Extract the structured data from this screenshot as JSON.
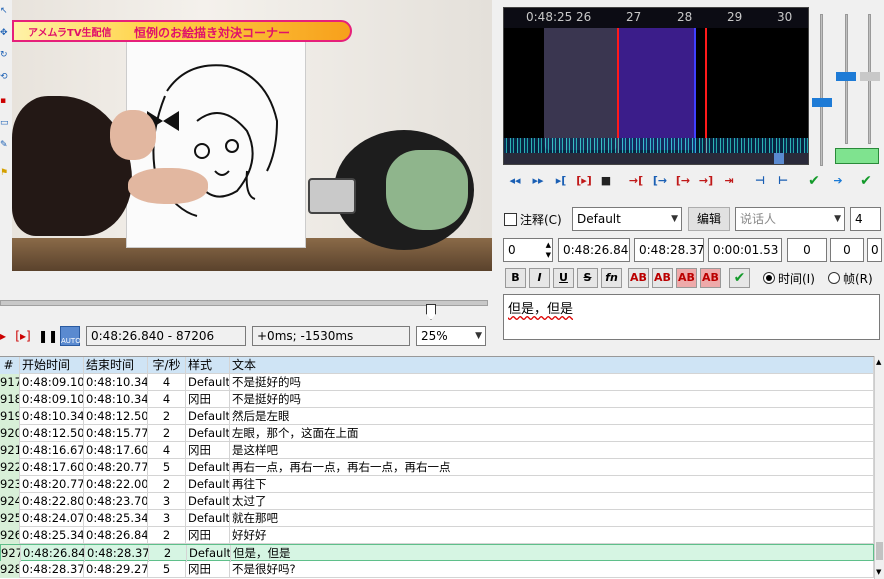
{
  "video": {
    "banner_left": "アメムラTV生配信",
    "banner_title": "恒例のお絵描き対決コーナー"
  },
  "video_controls": {
    "position_text": "0:48:26.840 - 87206",
    "offset_text": "+0ms; -1530ms",
    "zoom_value": "25%"
  },
  "audio": {
    "time_label": "0:48:25",
    "ticks": [
      "26",
      "27",
      "28",
      "29",
      "30"
    ]
  },
  "editor": {
    "comment_label": "注释(C)",
    "style_value": "Default",
    "edit_button": "编辑",
    "actor_placeholder": "说话人",
    "effect_value": "4",
    "layer_value": "0",
    "start_time": "0:48:26.84",
    "end_time": "0:48:28.37",
    "duration": "0:00:01.53",
    "margin_l": "0",
    "margin_r": "0",
    "margin_v": "0",
    "format_buttons": [
      "B",
      "I",
      "U",
      "S",
      "fn",
      "AB",
      "AB",
      "AB",
      "AB"
    ],
    "time_radio": "时间(I)",
    "frame_radio": "帧(R)",
    "text": "但是，但是"
  },
  "grid": {
    "headers": {
      "num": "#",
      "start": "开始时间",
      "end": "结束时间",
      "cps": "字/秒",
      "style": "样式",
      "text": "文本"
    },
    "rows": [
      {
        "num": "917",
        "start": "0:48:09.10",
        "end": "0:48:10.34",
        "cps": "4",
        "style": "Default",
        "text": "不是挺好的吗"
      },
      {
        "num": "918",
        "start": "0:48:09.10",
        "end": "0:48:10.34",
        "cps": "4",
        "style": "冈田",
        "text": "不是挺好的吗"
      },
      {
        "num": "919",
        "start": "0:48:10.34",
        "end": "0:48:12.50",
        "cps": "2",
        "style": "Default",
        "text": "然后是左眼"
      },
      {
        "num": "920",
        "start": "0:48:12.50",
        "end": "0:48:15.77",
        "cps": "2",
        "style": "Default",
        "text": "左眼，那个，这面在上面"
      },
      {
        "num": "921",
        "start": "0:48:16.67",
        "end": "0:48:17.60",
        "cps": "4",
        "style": "冈田",
        "text": "是这样吧"
      },
      {
        "num": "922",
        "start": "0:48:17.60",
        "end": "0:48:20.77",
        "cps": "5",
        "style": "Default",
        "text": "再右一点，再右一点，再右一点，再右一点"
      },
      {
        "num": "923",
        "start": "0:48:20.77",
        "end": "0:48:22.00",
        "cps": "2",
        "style": "Default",
        "text": "再往下"
      },
      {
        "num": "924",
        "start": "0:48:22.80",
        "end": "0:48:23.70",
        "cps": "3",
        "style": "Default",
        "text": "太过了"
      },
      {
        "num": "925",
        "start": "0:48:24.07",
        "end": "0:48:25.34",
        "cps": "3",
        "style": "Default",
        "text": "就在那吧"
      },
      {
        "num": "926",
        "start": "0:48:25.34",
        "end": "0:48:26.84",
        "cps": "2",
        "style": "冈田",
        "text": "好好好"
      },
      {
        "num": "927",
        "start": "0:48:26.84",
        "end": "0:48:28.37",
        "cps": "2",
        "style": "Default",
        "text": "但是，但是"
      },
      {
        "num": "928",
        "start": "0:48:28.37",
        "end": "0:48:29.27",
        "cps": "5",
        "style": "冈田",
        "text": "不是很好吗?"
      }
    ],
    "selected_index": 10
  }
}
